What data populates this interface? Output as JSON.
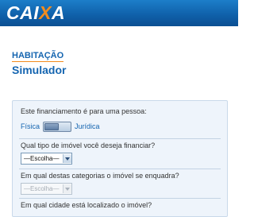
{
  "header": {
    "logo_main": "CAIXA"
  },
  "section": {
    "label": "HABITAÇÃO"
  },
  "page": {
    "title": "Simulador"
  },
  "form": {
    "q1": {
      "label": "Este financiamento é para uma pessoa:",
      "option_left": "Física",
      "option_right": "Jurídica",
      "selected": "Física"
    },
    "q2": {
      "label": "Qual tipo de imóvel você deseja financiar?",
      "value": "—Escolha—",
      "enabled": true
    },
    "q3": {
      "label": "Em qual destas categorias o imóvel se enquadra?",
      "value": "—Escolha—",
      "enabled": false
    },
    "q4": {
      "label": "Em qual cidade está localizado o imóvel?"
    }
  },
  "colors": {
    "header_blue": "#0f5fa8",
    "brand_orange": "#f28c1e",
    "title_blue": "#1565b0",
    "panel_bg": "#eef4fb"
  }
}
